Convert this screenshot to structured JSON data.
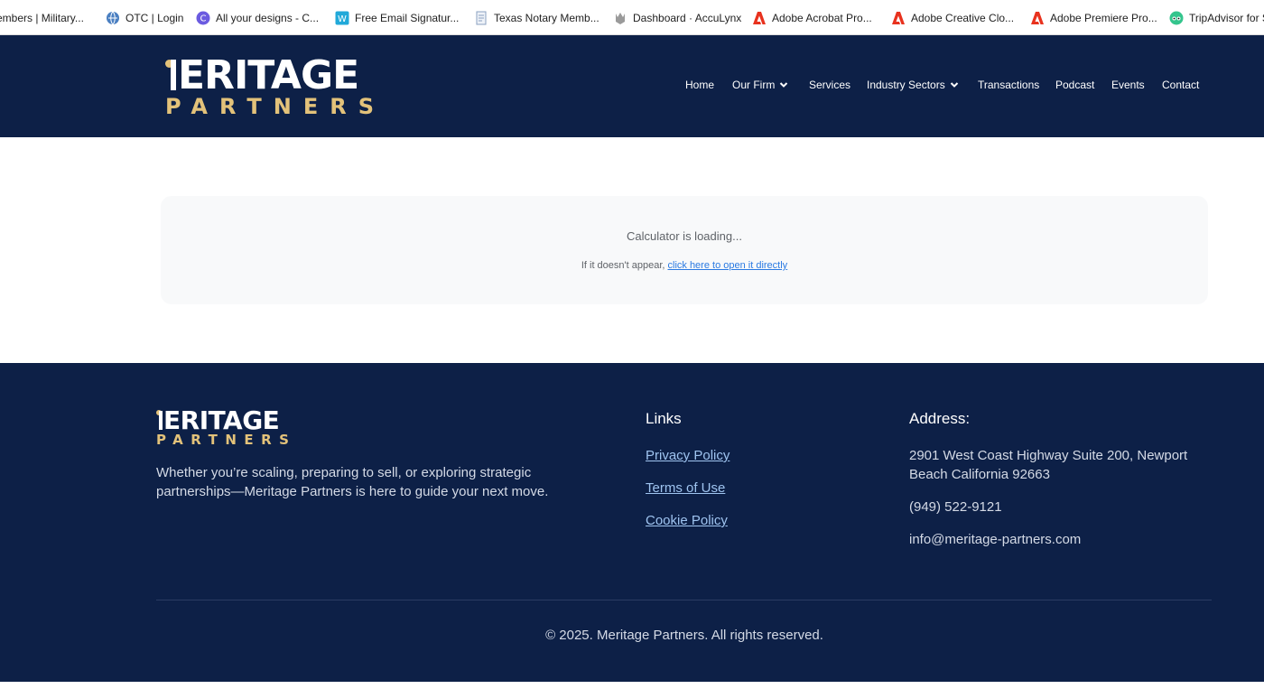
{
  "bookmarks": [
    {
      "label": "embers | Military...",
      "icon": "none"
    },
    {
      "label": "OTC | Login",
      "icon": "globe-icon"
    },
    {
      "label": "All your designs - C...",
      "icon": "canva-icon"
    },
    {
      "label": "Free Email Signatur...",
      "icon": "wisestamp-icon"
    },
    {
      "label": "Texas Notary Memb...",
      "icon": "page-icon"
    },
    {
      "label": "Dashboard · AccuLynx",
      "icon": "acculynx-icon"
    },
    {
      "label": "Adobe Acrobat Pro...",
      "icon": "adobe-icon"
    },
    {
      "label": "Adobe Creative Clo...",
      "icon": "adobe-icon"
    },
    {
      "label": "Adobe Premiere Pro...",
      "icon": "adobe-icon"
    },
    {
      "label": "TripAdvisor for S",
      "icon": "tripadvisor-icon"
    }
  ],
  "header": {
    "logo_top": "MERITAGE",
    "logo_top_rest": "ERITAGE",
    "logo_bottom": "PARTNERS",
    "nav": [
      {
        "label": "Home",
        "dropdown": false
      },
      {
        "label": "Our Firm",
        "dropdown": true
      },
      {
        "label": "Services",
        "dropdown": false
      },
      {
        "label": "Industry Sectors",
        "dropdown": true
      },
      {
        "label": "Transactions",
        "dropdown": false
      },
      {
        "label": "Podcast",
        "dropdown": false
      },
      {
        "label": "Events",
        "dropdown": false
      },
      {
        "label": "Contact",
        "dropdown": false
      }
    ]
  },
  "calculator": {
    "loading_text": "Calculator is loading...",
    "fallback_prefix": "If it doesn't appear, ",
    "fallback_link": "click here to open it directly"
  },
  "footer": {
    "logo_top_rest": "ERITAGE",
    "logo_bottom": "PARTNERS",
    "tagline": "Whether you’re scaling, preparing to sell, or exploring strategic partnerships—Meritage Partners is here to guide your next move.",
    "links_title": "Links",
    "links": [
      "Privacy Policy",
      "Terms of Use",
      "Cookie Policy"
    ],
    "address_title": "Address:",
    "address": "2901 West Coast Highway Suite 200, Newport Beach California 92663",
    "phone": "(949) 522-9121",
    "email": "info@meritage-partners.com",
    "copyright": "© 2025. Meritage Partners. All rights reserved."
  },
  "colors": {
    "navy": "#0d2047",
    "gold": "#e3c27a",
    "link_blue": "#9fc4f0"
  }
}
